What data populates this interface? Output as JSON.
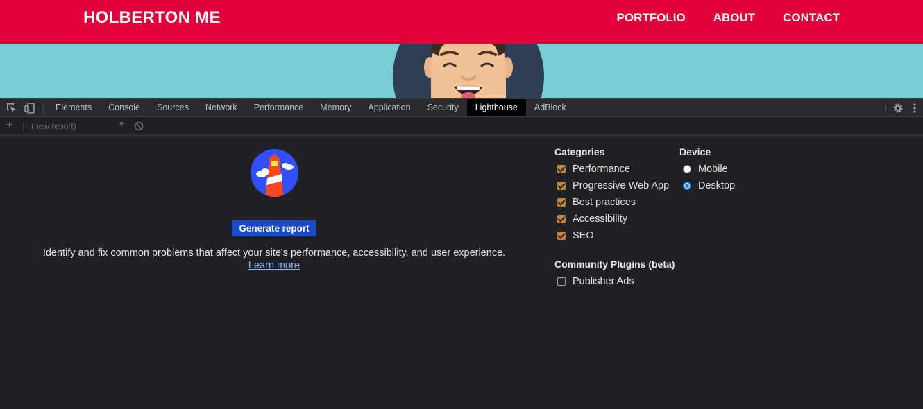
{
  "site": {
    "brand": "HOLBERTON ME",
    "nav": [
      "PORTFOLIO",
      "ABOUT",
      "CONTACT"
    ]
  },
  "devtools": {
    "tabs": [
      "Elements",
      "Console",
      "Sources",
      "Network",
      "Performance",
      "Memory",
      "Application",
      "Security",
      "Lighthouse",
      "AdBlock"
    ],
    "active_tab": "Lighthouse",
    "report_select": "(new report)"
  },
  "lighthouse": {
    "generate_label": "Generate report",
    "description": "Identify and fix common problems that affect your site's performance, accessibility, and user experience.",
    "learn_more": "Learn more",
    "categories_title": "Categories",
    "categories": [
      "Performance",
      "Progressive Web App",
      "Best practices",
      "Accessibility",
      "SEO"
    ],
    "device_title": "Device",
    "devices": [
      "Mobile",
      "Desktop"
    ],
    "selected_device": "Desktop",
    "plugins_title": "Community Plugins (beta)",
    "plugins": [
      "Publisher Ads"
    ]
  },
  "colors": {
    "header": "#e2003b",
    "hero": "#78ced4",
    "devtools_bg": "#202124",
    "generate_button": "#1a49c9",
    "checkbox": "#c78634",
    "link": "#8ab4f8"
  },
  "icons": [
    "inspect-element-icon",
    "device-toolbar-icon",
    "settings-gear-icon",
    "more-vertical-icon",
    "add-icon",
    "dropdown-arrow-icon",
    "clear-icon",
    "lighthouse-logo-icon"
  ]
}
